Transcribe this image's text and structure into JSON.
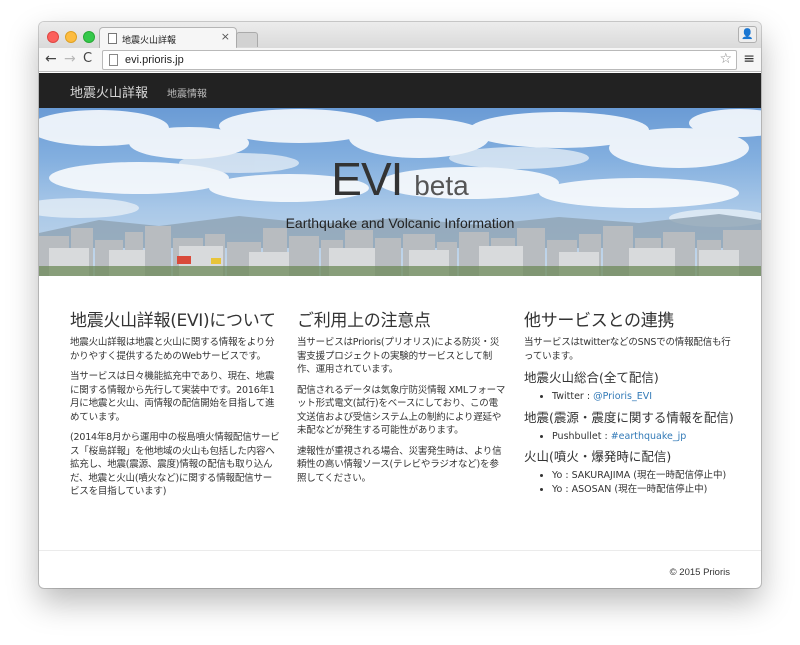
{
  "browser": {
    "tab_title": "地震火山詳報",
    "tab_close": "×",
    "url": "evi.prioris.jp",
    "back": "←",
    "forward": "→",
    "reload": "C",
    "star": "☆",
    "menu": "≡",
    "profile": "👤"
  },
  "navbar": {
    "brand": "地震火山詳報",
    "link": "地震情報"
  },
  "hero": {
    "title": "EVI",
    "beta": "beta",
    "subtitle": "Earthquake and Volcanic Information"
  },
  "col1": {
    "heading": "地震火山詳報(EVI)について",
    "p1": "地震火山詳報は地震と火山に関する情報をより分かりやすく提供するためのWebサービスです。",
    "p2": "当サービスは日々機能拡充中であり、現在、地震に関する情報から先行して実装中です。2016年1月に地震と火山、両情報の配信開始を目指して進めています。",
    "p3": "(2014年8月から運用中の桜島噴火情報配信サービス「桜島詳報」を他地域の火山も包括した内容へ拡充し、地震(震源、震度)情報の配信も取り込んだ、地震と火山(噴火など)に関する情報配信サービスを目指しています)"
  },
  "col2": {
    "heading": "ご利用上の注意点",
    "p1": "当サービスはPrioris(プリオリス)による防災・災害支援プロジェクトの実験的サービスとして制作、運用されています。",
    "p2": "配信されるデータは気象庁防災情報 XMLフォーマット形式電文(試行)をベースにしており、この電文送信および受信システム上の制約により遅延や未配などが発生する可能性があります。",
    "p3": "速報性が重視される場合、災害発生時は、より信頼性の高い情報ソース(テレビやラジオなど)を参照してください。"
  },
  "col3": {
    "heading": "他サービスとの連携",
    "p1": "当サービスはtwitterなどのSNSでの情報配信も行っています。",
    "sub1": "地震火山総合(全て配信)",
    "sub1_item_label": "Twitter : ",
    "sub1_item_link": "@Prioris_EVI",
    "sub2": "地震(震源・震度に関する情報を配信)",
    "sub2_item_label": "Pushbullet : ",
    "sub2_item_link": "#earthquake_jp",
    "sub3": "火山(噴火・爆発時に配信)",
    "sub3_item1": "Yo : SAKURAJIMA (現在一時配信停止中)",
    "sub3_item2": "Yo : ASOSAN (現在一時配信停止中)"
  },
  "footer": {
    "copyright": "© 2015 Prioris"
  },
  "colors": {
    "navbar_bg": "#222222",
    "link": "#337ab7"
  }
}
